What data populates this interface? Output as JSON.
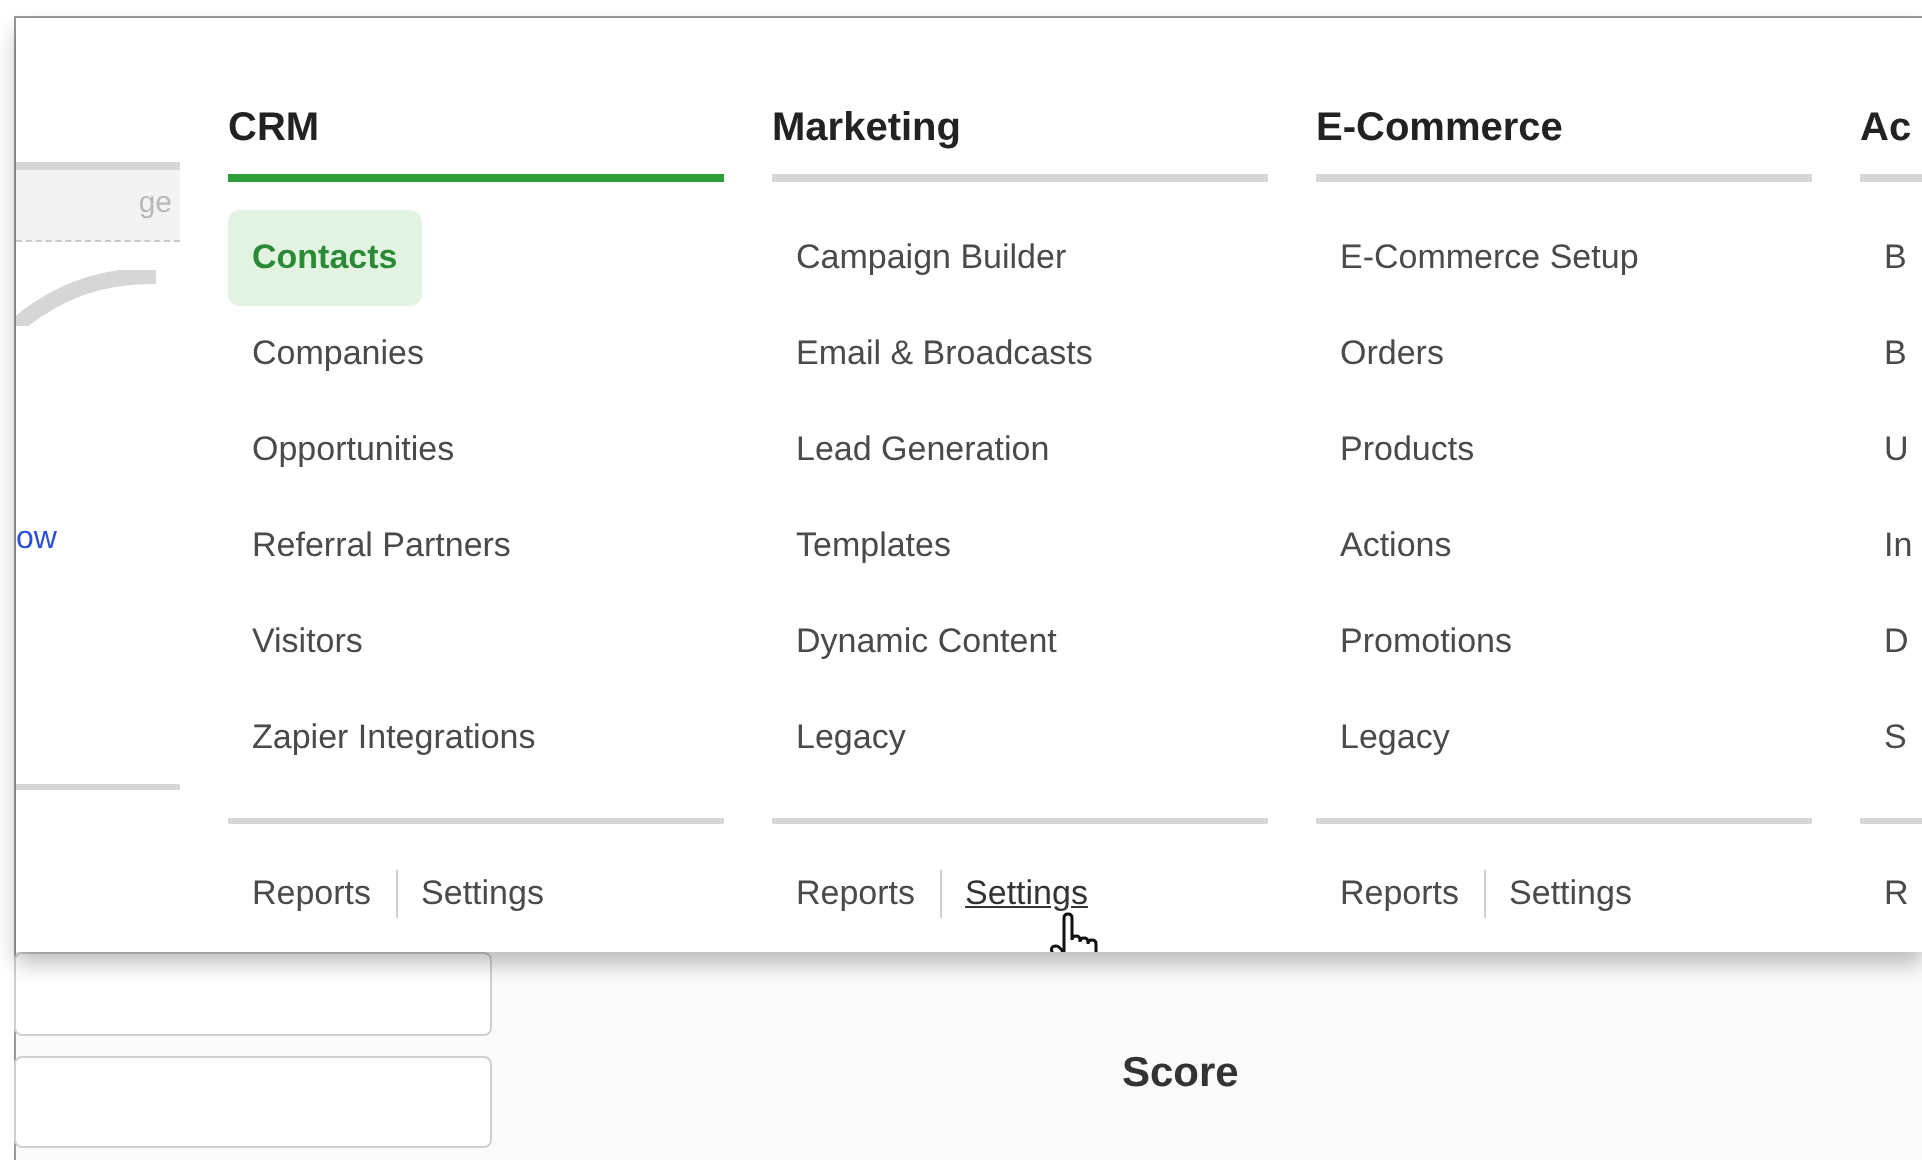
{
  "left_column": {
    "search": {
      "placeholder": "ge"
    },
    "link": "ow"
  },
  "columns": [
    {
      "title": "CRM",
      "selected": true,
      "items": [
        {
          "label": "Contacts",
          "selected": true
        },
        {
          "label": "Companies",
          "selected": false
        },
        {
          "label": "Opportunities",
          "selected": false
        },
        {
          "label": "Referral Partners",
          "selected": false
        },
        {
          "label": "Visitors",
          "selected": false
        },
        {
          "label": "Zapier Integrations",
          "selected": false
        }
      ],
      "footer": [
        {
          "label": "Reports",
          "hovered": false
        },
        {
          "label": "Settings",
          "hovered": false
        }
      ]
    },
    {
      "title": "Marketing",
      "selected": false,
      "items": [
        {
          "label": "Campaign Builder",
          "selected": false
        },
        {
          "label": "Email & Broadcasts",
          "selected": false
        },
        {
          "label": "Lead Generation",
          "selected": false
        },
        {
          "label": "Templates",
          "selected": false
        },
        {
          "label": "Dynamic Content",
          "selected": false
        },
        {
          "label": "Legacy",
          "selected": false
        }
      ],
      "footer": [
        {
          "label": "Reports",
          "hovered": false
        },
        {
          "label": "Settings",
          "hovered": true
        }
      ]
    },
    {
      "title": "E-Commerce",
      "selected": false,
      "items": [
        {
          "label": "E-Commerce Setup",
          "selected": false
        },
        {
          "label": "Orders",
          "selected": false
        },
        {
          "label": "Products",
          "selected": false
        },
        {
          "label": "Actions",
          "selected": false
        },
        {
          "label": "Promotions",
          "selected": false
        },
        {
          "label": "Legacy",
          "selected": false
        }
      ],
      "footer": [
        {
          "label": "Reports",
          "hovered": false
        },
        {
          "label": "Settings",
          "hovered": false
        }
      ]
    },
    {
      "title": "Ac",
      "selected": false,
      "items": [
        {
          "label": "B",
          "selected": false
        },
        {
          "label": "B",
          "selected": false
        },
        {
          "label": "U",
          "selected": false
        },
        {
          "label": "In",
          "selected": false
        },
        {
          "label": "D",
          "selected": false
        },
        {
          "label": "S",
          "selected": false
        }
      ],
      "footer": [
        {
          "label": "R",
          "hovered": false
        }
      ]
    }
  ],
  "score_label": "Score"
}
